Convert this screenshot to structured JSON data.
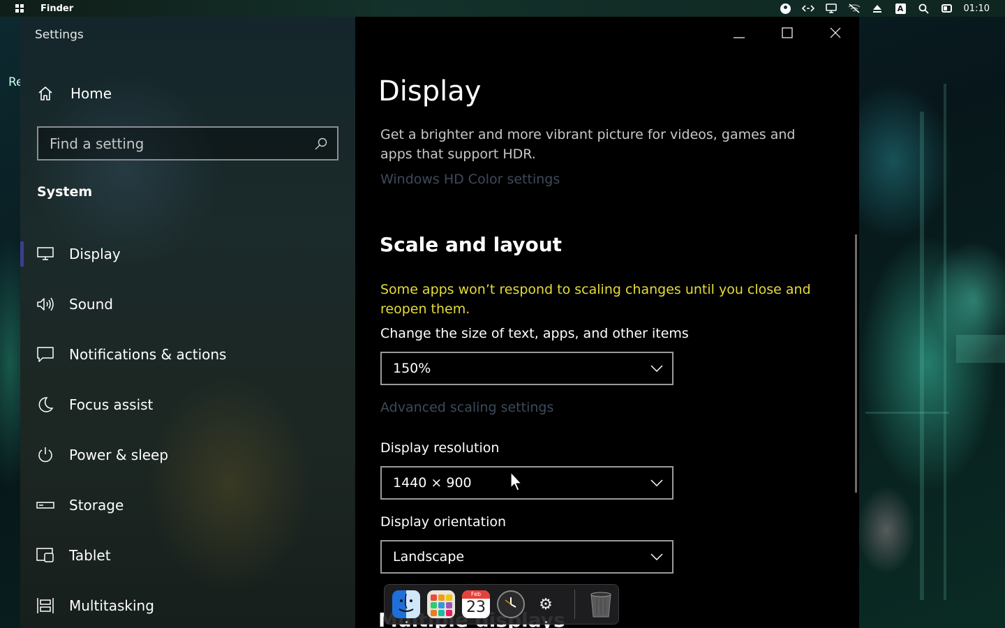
{
  "menubar": {
    "app_name": "Finder",
    "clock": "01:10",
    "tray_icons": [
      "account-circle-icon",
      "code-icon",
      "display-icon",
      "wifi-off-icon",
      "eject-icon",
      "input-method-icon",
      "search-icon",
      "control-center-icon"
    ],
    "input_method_letter": "A"
  },
  "desktop": {
    "stub_text": "Re"
  },
  "window": {
    "title": "Settings",
    "caption_buttons": [
      "minimize-icon",
      "maximize-icon",
      "close-icon"
    ]
  },
  "sidebar": {
    "home_label": "Home",
    "search_placeholder": "Find a setting",
    "section_label": "System",
    "items": [
      {
        "label": "Display",
        "icon": "monitor-icon",
        "active": true
      },
      {
        "label": "Sound",
        "icon": "speaker-icon",
        "active": false
      },
      {
        "label": "Notifications & actions",
        "icon": "notification-icon",
        "active": false
      },
      {
        "label": "Focus assist",
        "icon": "moon-icon",
        "active": false
      },
      {
        "label": "Power & sleep",
        "icon": "power-icon",
        "active": false
      },
      {
        "label": "Storage",
        "icon": "storage-icon",
        "active": false
      },
      {
        "label": "Tablet",
        "icon": "tablet-icon",
        "active": false
      },
      {
        "label": "Multitasking",
        "icon": "multitasking-icon",
        "active": false
      }
    ]
  },
  "content": {
    "page_title": "Display",
    "hdr_description": "Get a brighter and more vibrant picture for videos, games and apps that support HDR.",
    "hdr_link": "Windows HD Color settings",
    "scale_heading": "Scale and layout",
    "scale_warning": "Some apps won’t respond to scaling changes until you close and reopen them.",
    "size_label": "Change the size of text, apps, and other items",
    "size_value": "150%",
    "advanced_link": "Advanced scaling settings",
    "resolution_label": "Display resolution",
    "resolution_value": "1440 × 900",
    "orientation_label": "Display orientation",
    "orientation_value": "Landscape",
    "next_heading": "Multiple displays"
  },
  "dock": {
    "items": [
      "finder-icon",
      "launchpad-icon",
      "calendar-icon",
      "clock-icon",
      "settings-gear-icon",
      "trash-icon"
    ],
    "calendar_month": "Feb",
    "calendar_day": "23"
  },
  "colors": {
    "warning_text": "#e6dc3a",
    "link_text": "#3d4a5c",
    "active_indicator": "#3a3f8f",
    "content_bg": "#000000"
  }
}
